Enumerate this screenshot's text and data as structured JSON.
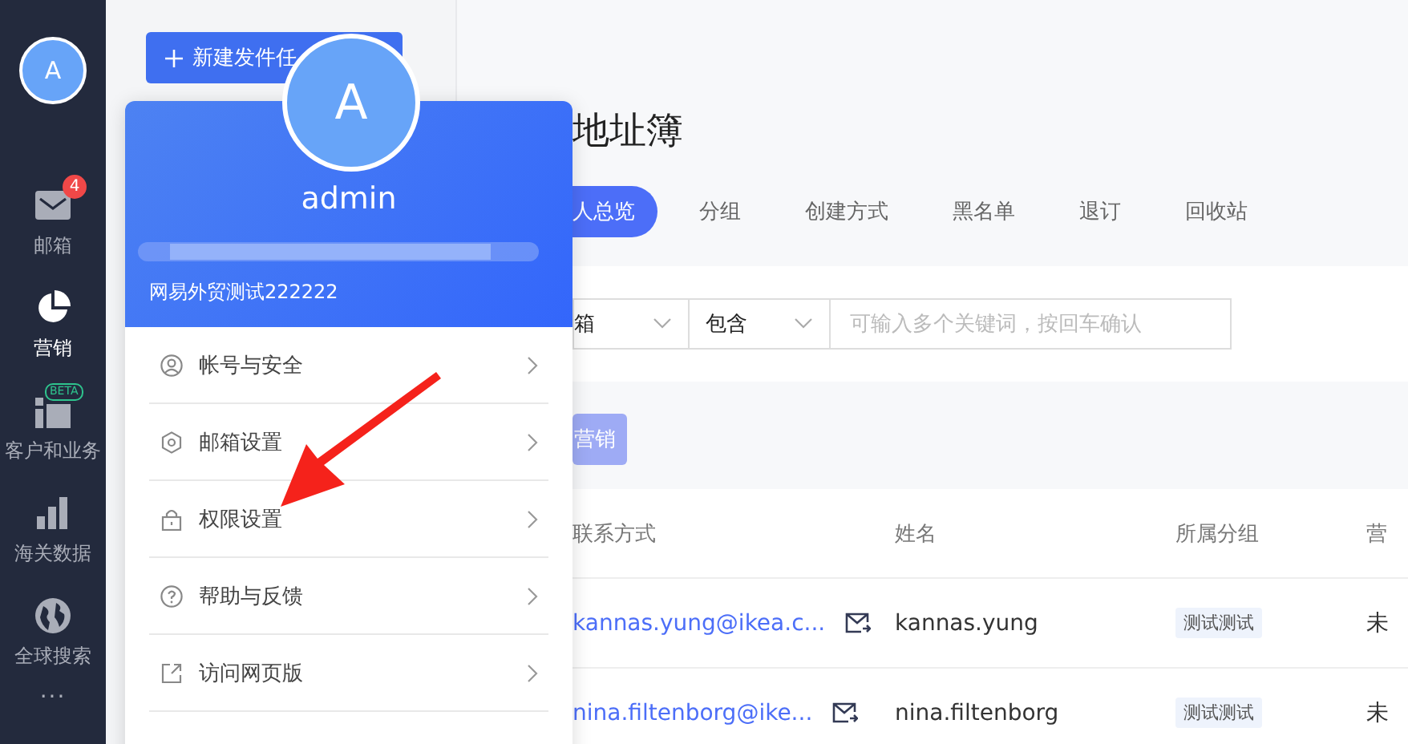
{
  "rail": {
    "avatar": "A",
    "items": [
      {
        "label": "邮箱",
        "kind": "mail",
        "badge": "4",
        "selected": false
      },
      {
        "label": "营销",
        "kind": "pie",
        "selected": true
      },
      {
        "label": "客户和业务",
        "kind": "blocks",
        "tag": "BETA",
        "selected": false
      },
      {
        "label": "海关数据",
        "kind": "bars",
        "selected": false
      },
      {
        "label": "全球搜索",
        "kind": "globe",
        "selected": false
      }
    ],
    "more": "···"
  },
  "panel": {
    "new_button": "新建发件任"
  },
  "page": {
    "title": "地址簿",
    "tabs": [
      {
        "label": "人总览",
        "selected": true
      },
      {
        "label": "分组",
        "selected": false
      },
      {
        "label": "创建方式",
        "selected": false
      },
      {
        "label": "黑名单",
        "selected": false
      },
      {
        "label": "退订",
        "selected": false
      },
      {
        "label": "回收站",
        "selected": false
      }
    ],
    "filter": {
      "field": "箱",
      "operator": "包含",
      "placeholder": "可输入多个关键词，按回车确认"
    },
    "action_button": {
      "label": "营销",
      "disabled": true
    }
  },
  "table": {
    "columns": [
      "联系方式",
      "姓名",
      "所属分组",
      "营"
    ],
    "rows": [
      {
        "email": "kannas.yung@ikea.c...",
        "name": "kannas.yung",
        "group": "测试测试",
        "status": "未"
      },
      {
        "email": "nina.filtenborg@ike...",
        "name": "nina.filtenborg",
        "group": "测试测试",
        "status": "未"
      }
    ]
  },
  "popup": {
    "avatar": "A",
    "name": "admin",
    "company": "网易外贸测试222222",
    "menu": [
      {
        "label": "帐号与安全",
        "kind": "user"
      },
      {
        "label": "邮箱设置",
        "kind": "hex"
      },
      {
        "label": "权限设置",
        "kind": "lock"
      },
      {
        "label": "帮助与反馈",
        "kind": "help"
      },
      {
        "label": "访问网页版",
        "kind": "external"
      }
    ]
  }
}
